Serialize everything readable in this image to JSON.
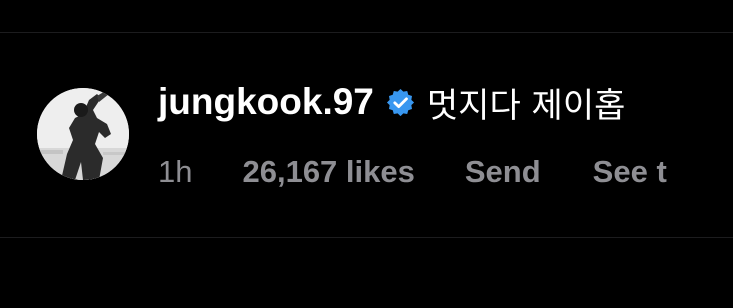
{
  "comment": {
    "username": "jungkook.97",
    "verified_icon": "verified-badge-icon",
    "text": "멋지다 제이홉"
  },
  "meta": {
    "time": "1h",
    "likes": "26,167 likes",
    "send": "Send",
    "see": "See t"
  },
  "colors": {
    "background": "#000000",
    "username": "#ffffff",
    "meta": "#8e8e93",
    "verified": "#3897f0"
  }
}
